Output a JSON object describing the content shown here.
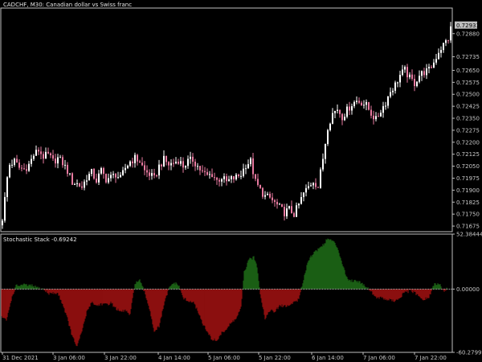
{
  "header": {
    "symbol_line": "CADCHF, M30:  Canadian dollar vs Swiss franc",
    "indicator_label": "Stochastic Stack -0.69242"
  },
  "colors": {
    "background": "#000000",
    "frame": "#c0c0c0",
    "candle_bull": "#ffffff",
    "candle_bear": "#e87aa0",
    "hist_positive": "#1a5e14",
    "hist_negative": "#8b0f0f",
    "zero_line": "#c0c0c0",
    "price_tag_bg": "#c0c0c0"
  },
  "chart_data": [
    {
      "type": "candlestick",
      "title": "CADCHF, M30:  Canadian dollar vs Swiss franc",
      "ylim": [
        0.7164,
        0.7304
      ],
      "y_ticks": [
        "0.72880",
        "0.72735",
        "0.72650",
        "0.72575",
        "0.72500",
        "0.72425",
        "0.72350",
        "0.72275",
        "0.72200",
        "0.72125",
        "0.72050",
        "0.71975",
        "0.71900",
        "0.71825",
        "0.71750",
        "0.71675"
      ],
      "y_tick_values": [
        0.7288,
        0.72735,
        0.7265,
        0.72575,
        0.725,
        0.72425,
        0.7235,
        0.72275,
        0.722,
        0.72125,
        0.7205,
        0.71975,
        0.719,
        0.71825,
        0.7175,
        0.71675
      ],
      "last_price": "0.72931",
      "last_price_value": 0.72931,
      "x_labels": [
        "31 Dec 2021",
        "3 Jan 06:00",
        "3 Jan 22:00",
        "4 Jan 14:00",
        "5 Jan 06:00",
        "5 Jan 22:00",
        "6 Jan 14:00",
        "7 Jan 06:00",
        "7 Jan 22:00"
      ],
      "close_path": [
        [
          0,
          0.7168
        ],
        [
          4,
          0.7174
        ],
        [
          8,
          0.7195
        ],
        [
          12,
          0.7206
        ],
        [
          18,
          0.7208
        ],
        [
          24,
          0.7204
        ],
        [
          30,
          0.7203
        ],
        [
          36,
          0.7206
        ],
        [
          42,
          0.7212
        ],
        [
          48,
          0.7215
        ],
        [
          54,
          0.7211
        ],
        [
          60,
          0.7212
        ],
        [
          66,
          0.7208
        ],
        [
          72,
          0.721
        ],
        [
          78,
          0.7207
        ],
        [
          84,
          0.7202
        ],
        [
          90,
          0.7195
        ],
        [
          96,
          0.7194
        ],
        [
          102,
          0.7192
        ],
        [
          108,
          0.7198
        ],
        [
          114,
          0.7201
        ],
        [
          120,
          0.7196
        ],
        [
          126,
          0.7202
        ],
        [
          132,
          0.7197
        ],
        [
          138,
          0.7198
        ],
        [
          144,
          0.72
        ],
        [
          150,
          0.7197
        ],
        [
          156,
          0.7204
        ],
        [
          162,
          0.7208
        ],
        [
          168,
          0.721
        ],
        [
          174,
          0.7208
        ],
        [
          180,
          0.7202
        ],
        [
          186,
          0.72
        ],
        [
          192,
          0.7197
        ],
        [
          198,
          0.7205
        ],
        [
          204,
          0.7209
        ],
        [
          210,
          0.7206
        ],
        [
          216,
          0.7207
        ],
        [
          222,
          0.7209
        ],
        [
          228,
          0.7205
        ],
        [
          234,
          0.7208
        ],
        [
          240,
          0.7209
        ],
        [
          246,
          0.7205
        ],
        [
          252,
          0.7201
        ],
        [
          258,
          0.7199
        ],
        [
          264,
          0.72
        ],
        [
          270,
          0.7196
        ],
        [
          276,
          0.7198
        ],
        [
          282,
          0.7195
        ],
        [
          288,
          0.7197
        ],
        [
          294,
          0.7198
        ],
        [
          300,
          0.72
        ],
        [
          306,
          0.7206
        ],
        [
          312,
          0.7208
        ],
        [
          318,
          0.7195
        ],
        [
          324,
          0.719
        ],
        [
          330,
          0.7186
        ],
        [
          336,
          0.7185
        ],
        [
          342,
          0.7182
        ],
        [
          348,
          0.7179
        ],
        [
          354,
          0.7176
        ],
        [
          360,
          0.7178
        ],
        [
          366,
          0.7175
        ],
        [
          372,
          0.7181
        ],
        [
          378,
          0.7188
        ],
        [
          384,
          0.7192
        ],
        [
          390,
          0.7196
        ],
        [
          396,
          0.7192
        ],
        [
          402,
          0.721
        ],
        [
          408,
          0.723
        ],
        [
          414,
          0.7238
        ],
        [
          420,
          0.7241
        ],
        [
          426,
          0.7236
        ],
        [
          432,
          0.724
        ],
        [
          438,
          0.7244
        ],
        [
          444,
          0.7246
        ],
        [
          450,
          0.7245
        ],
        [
          456,
          0.7243
        ],
        [
          462,
          0.7238
        ],
        [
          468,
          0.7234
        ],
        [
          474,
          0.724
        ],
        [
          480,
          0.7245
        ],
        [
          486,
          0.7252
        ],
        [
          492,
          0.7256
        ],
        [
          498,
          0.7262
        ],
        [
          504,
          0.7265
        ],
        [
          510,
          0.726
        ],
        [
          516,
          0.7257
        ],
        [
          522,
          0.7262
        ],
        [
          528,
          0.7264
        ],
        [
          534,
          0.7265
        ],
        [
          540,
          0.727
        ],
        [
          546,
          0.7277
        ],
        [
          552,
          0.7281
        ],
        [
          558,
          0.7285
        ],
        [
          562,
          0.72931
        ]
      ]
    },
    {
      "type": "histogram",
      "title": "Stochastic Stack -0.69242",
      "ylim": [
        -60.27991,
        52.38444
      ],
      "y_ticks": [
        "52.38444",
        "0.00000",
        "-60.27991"
      ],
      "y_tick_values": [
        52.38444,
        0.0,
        -60.27991
      ],
      "series": [
        {
          "values": [
            [
              0,
              -25
            ],
            [
              8,
              -30
            ],
            [
              14,
              -10
            ],
            [
              20,
              3
            ],
            [
              30,
              4
            ],
            [
              40,
              3
            ],
            [
              48,
              1
            ],
            [
              54,
              0
            ],
            [
              60,
              -4
            ],
            [
              66,
              -4
            ],
            [
              72,
              -4
            ],
            [
              78,
              -14
            ],
            [
              84,
              -28
            ],
            [
              90,
              -45
            ],
            [
              96,
              -55
            ],
            [
              102,
              -40
            ],
            [
              108,
              -22
            ],
            [
              114,
              -12
            ],
            [
              120,
              -16
            ],
            [
              126,
              -14
            ],
            [
              132,
              -15
            ],
            [
              138,
              -13
            ],
            [
              144,
              -18
            ],
            [
              150,
              -22
            ],
            [
              156,
              -20
            ],
            [
              162,
              -25
            ],
            [
              168,
              6
            ],
            [
              174,
              8
            ],
            [
              180,
              -3
            ],
            [
              186,
              -18
            ],
            [
              192,
              -40
            ],
            [
              198,
              -36
            ],
            [
              204,
              -15
            ],
            [
              210,
              0
            ],
            [
              216,
              6
            ],
            [
              222,
              4
            ],
            [
              228,
              -8
            ],
            [
              234,
              -12
            ],
            [
              240,
              -12
            ],
            [
              246,
              -20
            ],
            [
              252,
              -32
            ],
            [
              258,
              -41
            ],
            [
              264,
              -48
            ],
            [
              270,
              -49
            ],
            [
              276,
              -42
            ],
            [
              282,
              -38
            ],
            [
              288,
              -32
            ],
            [
              294,
              -28
            ],
            [
              300,
              -18
            ],
            [
              304,
              16
            ],
            [
              310,
              28
            ],
            [
              316,
              30
            ],
            [
              320,
              22
            ],
            [
              324,
              -4
            ],
            [
              330,
              -28
            ],
            [
              336,
              -20
            ],
            [
              342,
              -22
            ],
            [
              348,
              -16
            ],
            [
              354,
              -16
            ],
            [
              360,
              -16
            ],
            [
              366,
              -12
            ],
            [
              372,
              -10
            ],
            [
              378,
              10
            ],
            [
              384,
              28
            ],
            [
              390,
              34
            ],
            [
              396,
              38
            ],
            [
              402,
              42
            ],
            [
              408,
              48
            ],
            [
              414,
              46
            ],
            [
              420,
              40
            ],
            [
              426,
              25
            ],
            [
              432,
              10
            ],
            [
              438,
              8
            ],
            [
              444,
              8
            ],
            [
              450,
              6
            ],
            [
              456,
              2
            ],
            [
              462,
              -2
            ],
            [
              468,
              -8
            ],
            [
              474,
              -8
            ],
            [
              480,
              -10
            ],
            [
              486,
              -10
            ],
            [
              492,
              -12
            ],
            [
              498,
              -8
            ],
            [
              504,
              -3
            ],
            [
              510,
              -2
            ],
            [
              516,
              -3
            ],
            [
              522,
              -8
            ],
            [
              528,
              -10
            ],
            [
              534,
              -8
            ],
            [
              540,
              4
            ],
            [
              546,
              6
            ],
            [
              552,
              -2
            ],
            [
              556,
              0
            ]
          ]
        }
      ]
    }
  ]
}
